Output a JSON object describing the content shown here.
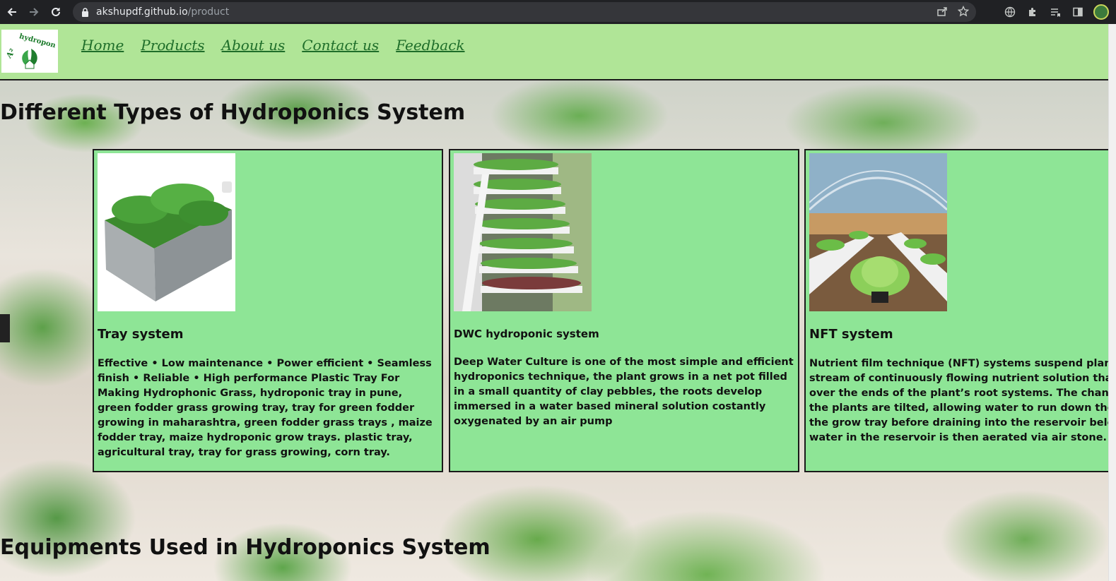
{
  "browser": {
    "url_host": "akshupdf.github.io",
    "url_path": "/product"
  },
  "nav": {
    "logo_text": "A² hydroponics",
    "links": [
      "Home",
      "Products",
      "About us",
      "Contact us",
      "Feedback"
    ]
  },
  "sections": {
    "types_title": "Different Types of Hydroponics System",
    "equipments_title": "Equipments Used in Hydroponics System"
  },
  "cards": [
    {
      "title": "Tray system",
      "description": "Effective • Low maintenance • Power efficient • Seamless finish • Reliable • High performance Plastic Tray For Making Hydrophonic Grass, hydroponic tray in pune, green fodder grass growing tray, tray for green fodder growing in maharashtra, green fodder grass trays , maize fodder tray, maize hydroponic grow trays. plastic tray, agricultural tray, tray for grass growing, corn tray."
    },
    {
      "title": "DWC hydroponic system",
      "description": "Deep Water Culture is one of the most simple and efficient hydroponics technique, the plant grows in a net pot filled in a small quantity of clay pebbles, the roots develop immersed in a water based mineral solution costantly oxygenated by an air pump"
    },
    {
      "title": "NFT system",
      "description_lines": [
        "Nutrient film technique (NFT) systems suspend plants a",
        "stream of continuously flowing nutrient solution that w",
        "over the ends of the plant’s root systems. The channels",
        "the plants are tilted, allowing water to run down the le",
        "the grow tray before draining into the reservoir below.",
        "water in the reservoir is then aerated via air stone."
      ]
    }
  ]
}
